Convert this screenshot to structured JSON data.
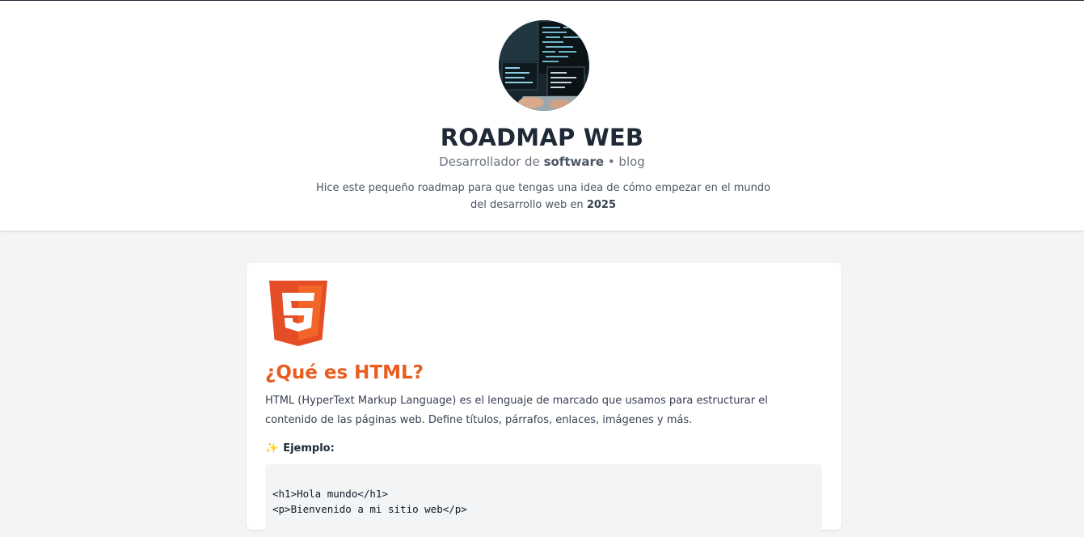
{
  "header": {
    "avatar_alt": "Pantallas con código",
    "title": "ROADMAP WEB",
    "subtitle_prefix": "Desarrollador de ",
    "subtitle_bold": "software",
    "subtitle_suffix": " • blog",
    "intro_text": "Hice este pequeño roadmap para que tengas una idea de cómo empezar en el mundo del desarrollo web en ",
    "intro_year": "2025"
  },
  "card": {
    "icon": "html5-icon",
    "title": "¿Qué es HTML?",
    "description": "HTML (HyperText Markup Language) es el lenguaje de marcado que usamos para estructurar el contenido de las páginas web. Define títulos, párrafos, enlaces, imágenes y más.",
    "example_icon": "✨",
    "example_label": "Ejemplo:",
    "code_lines": [
      "<h1>Hola mundo</h1>",
      "<p>Bienvenido a mi sitio web</p>"
    ]
  },
  "colors": {
    "accent": "#e85d20",
    "html5_orange": "#f16529",
    "html5_dark": "#e44d26",
    "page_bg": "#f3f4f6",
    "title": "#1f2937"
  }
}
